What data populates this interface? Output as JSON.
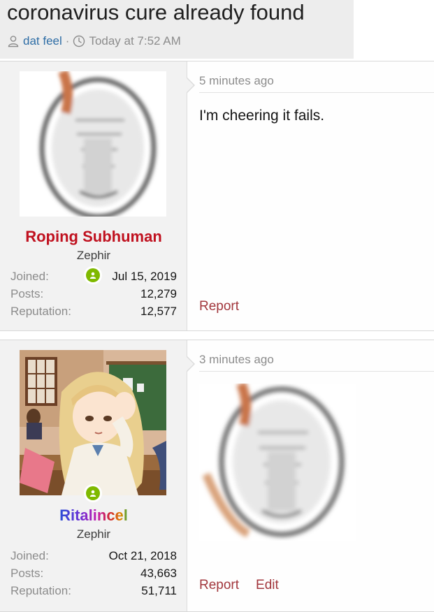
{
  "thread": {
    "title": "coronavirus cure already found",
    "author": "dat feel",
    "separator": "·",
    "date": "Today at 7:52 AM"
  },
  "posts": [
    {
      "username": "Roping Subhuman",
      "username_color": "#c0111f",
      "user_title": "Zephir",
      "stats": [
        {
          "label": "Joined:",
          "value": "Jul 15, 2019"
        },
        {
          "label": "Posts:",
          "value": "12,279"
        },
        {
          "label": "Reputation:",
          "value": "12,577"
        }
      ],
      "time": "5 minutes ago",
      "body": "I'm cheering it fails.",
      "actions": [
        "Report"
      ]
    },
    {
      "username": "Ritalincel",
      "user_title": "Zephir",
      "stats": [
        {
          "label": "Joined:",
          "value": "Oct 21, 2018"
        },
        {
          "label": "Posts:",
          "value": "43,663"
        },
        {
          "label": "Reputation:",
          "value": "51,711"
        }
      ],
      "time": "3 minutes ago",
      "actions": [
        "Report",
        "Edit"
      ]
    }
  ],
  "colors": {
    "link": "#2f6ea6",
    "action": "#a2373d",
    "online": "#7fb900",
    "header_bg": "#ededed",
    "sidebar_bg": "#f2f2f2"
  },
  "icons": {
    "author": "user-icon",
    "date": "clock-icon",
    "online": "online-status-icon"
  }
}
